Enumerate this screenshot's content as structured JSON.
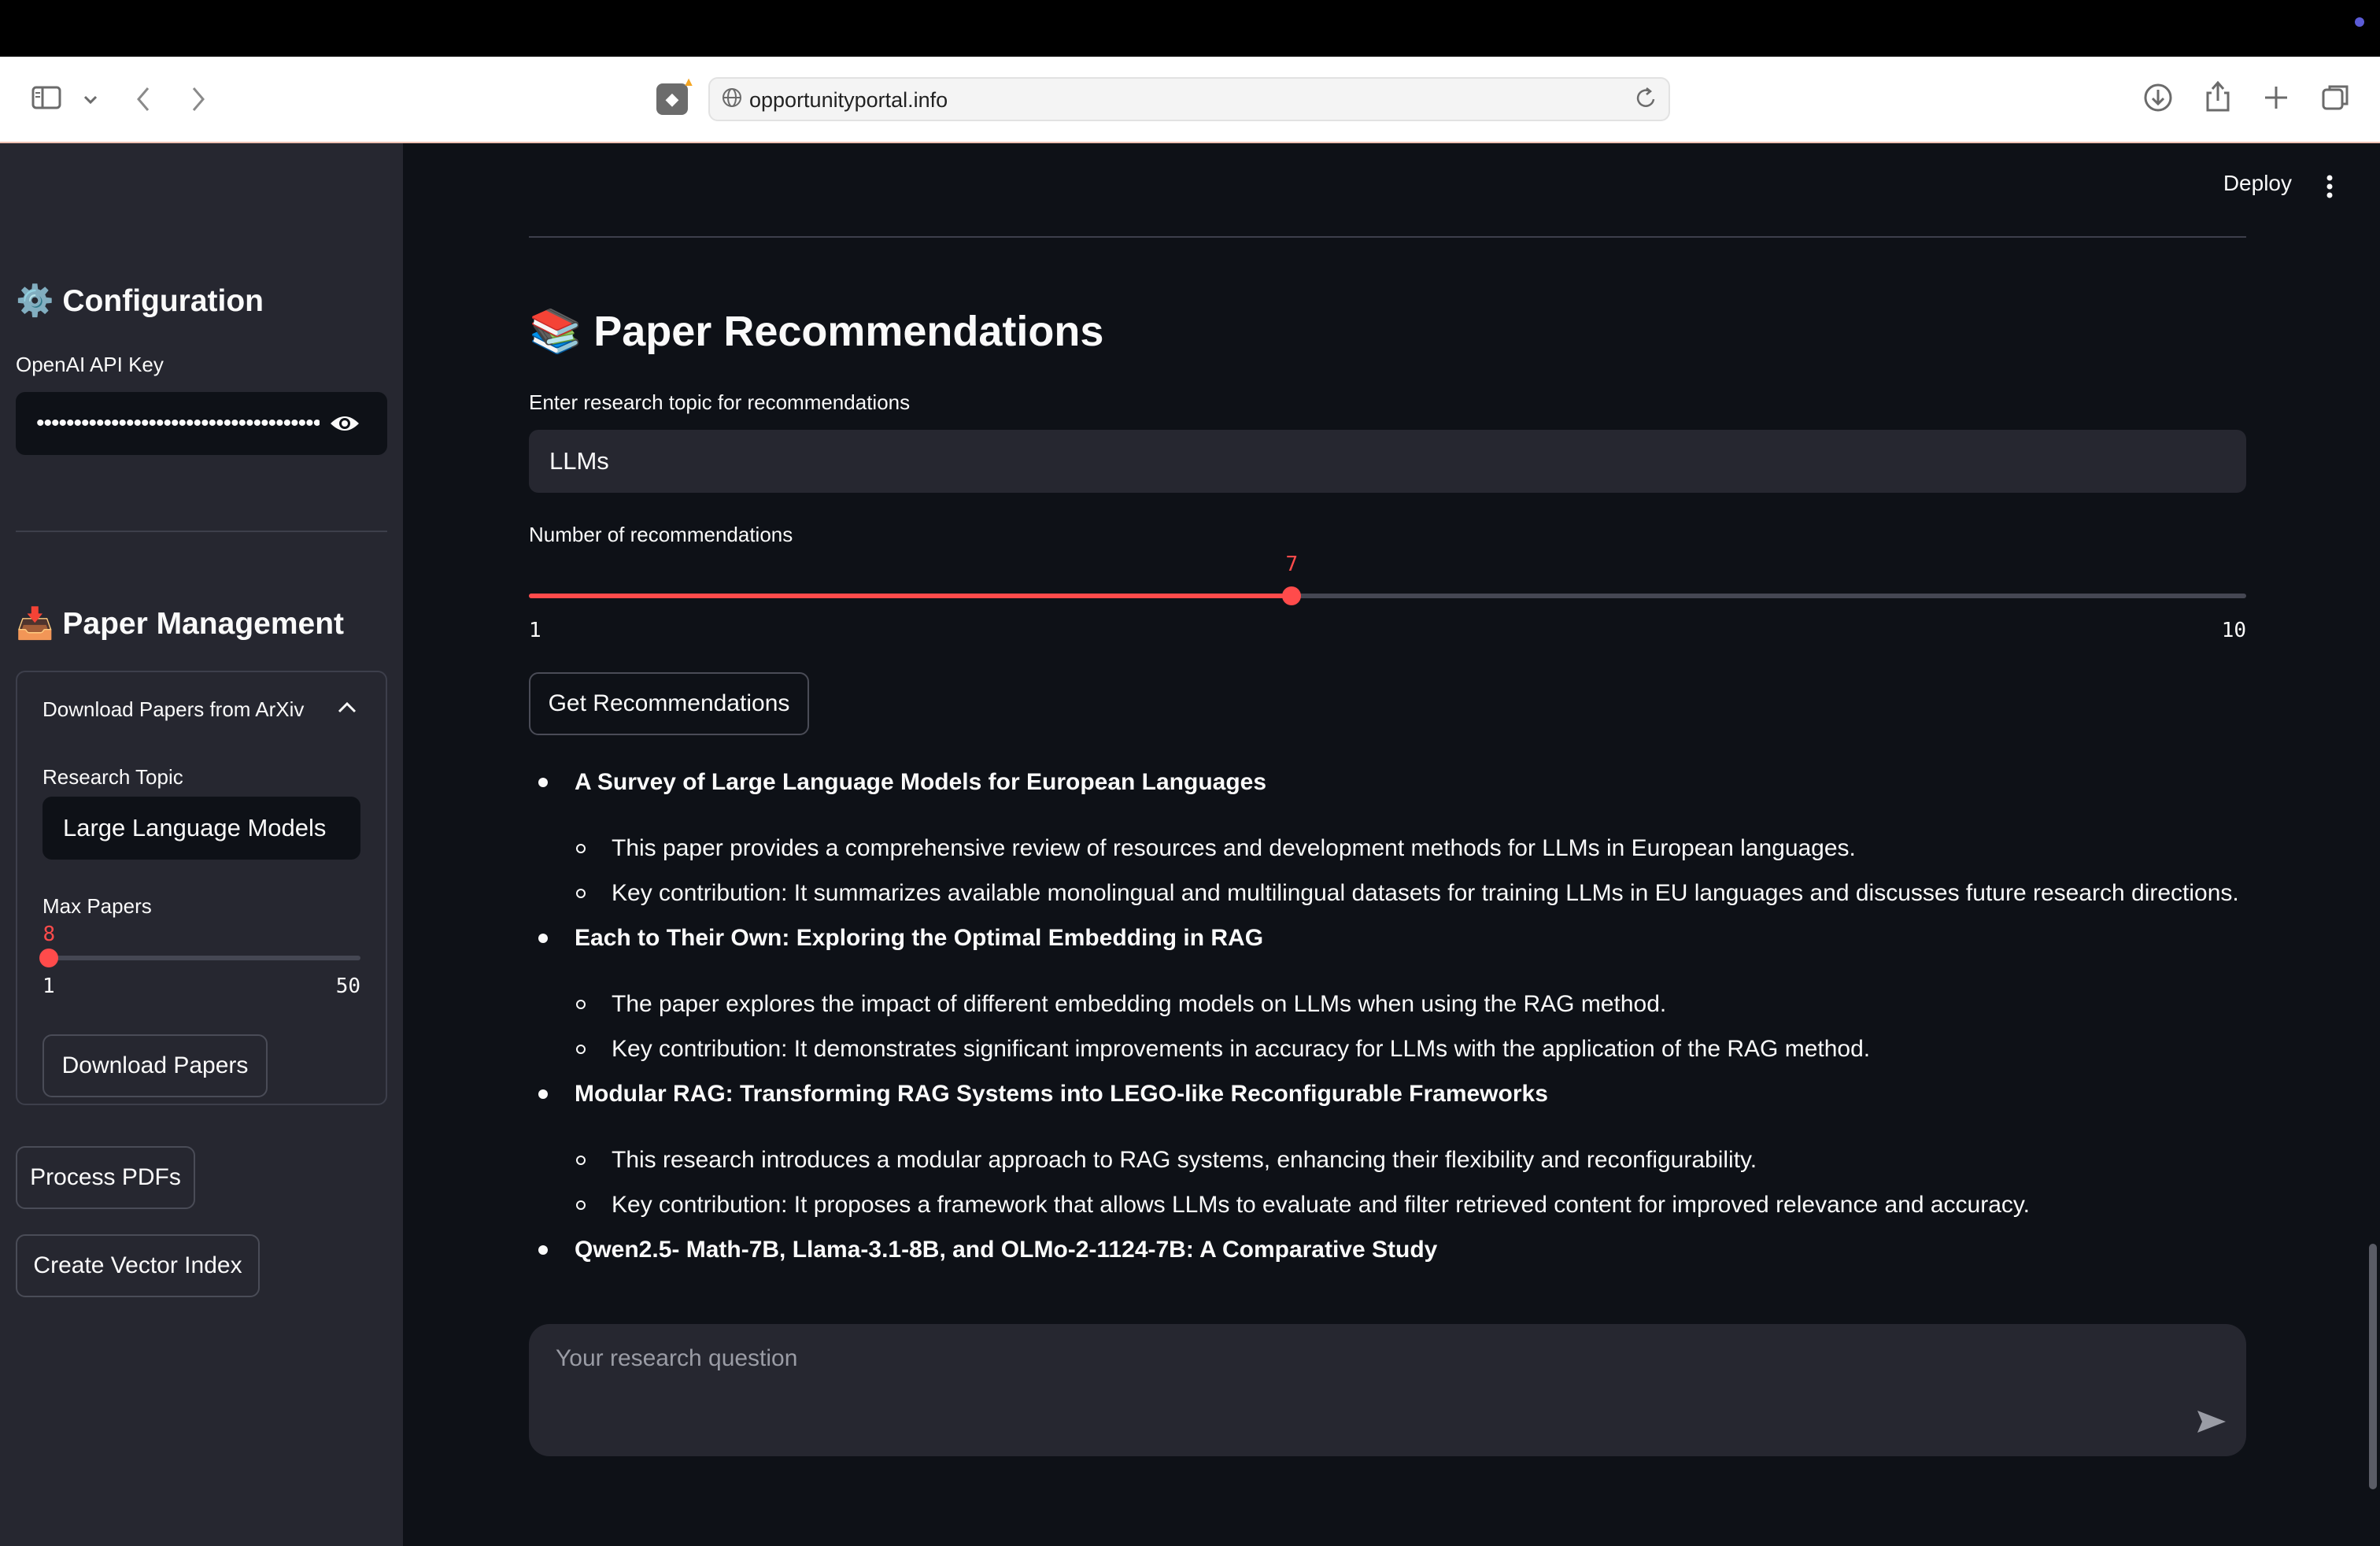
{
  "browser": {
    "url": "opportunityportal.info"
  },
  "sidebar": {
    "config_heading": "⚙️ Configuration",
    "api_key_label": "OpenAI API Key",
    "api_key_value": "••••••••••••••••••••••••••••••••••••••••",
    "management_heading": "📥 Paper Management",
    "expander_title": "Download Papers from ArXiv",
    "research_topic_label": "Research Topic",
    "research_topic_value": "Large Language Models",
    "max_papers_label": "Max Papers",
    "max_papers": {
      "value": 8,
      "min": 1,
      "max": 50,
      "value_text": "8",
      "min_text": "1",
      "max_text": "50"
    },
    "download_button": "Download Papers",
    "process_button": "Process PDFs",
    "vector_button": "Create Vector Index"
  },
  "main": {
    "deploy_label": "Deploy",
    "heading": "📚 Paper Recommendations",
    "topic_label": "Enter research topic for recommendations",
    "topic_value": "LLMs",
    "count_label": "Number of recommendations",
    "count_slider": {
      "value": 7,
      "min": 1,
      "max": 10,
      "value_text": "7",
      "min_text": "1",
      "max_text": "10"
    },
    "get_button": "Get Recommendations",
    "recommendations": [
      {
        "title": "A Survey of Large Language Models for European Languages",
        "points": [
          "This paper provides a comprehensive review of resources and development methods for LLMs in European languages.",
          "Key contribution: It summarizes available monolingual and multilingual datasets for training LLMs in EU languages and discusses future research directions."
        ]
      },
      {
        "title": "Each to Their Own: Exploring the Optimal Embedding in RAG",
        "points": [
          "The paper explores the impact of different embedding models on LLMs when using the RAG method.",
          "Key contribution: It demonstrates significant improvements in accuracy for LLMs with the application of the RAG method."
        ]
      },
      {
        "title": "Modular RAG: Transforming RAG Systems into LEGO-like Reconfigurable Frameworks",
        "points": [
          "This research introduces a modular approach to RAG systems, enhancing their flexibility and reconfigurability.",
          "Key contribution: It proposes a framework that allows LLMs to evaluate and filter retrieved content for improved relevance and accuracy."
        ]
      },
      {
        "title": "Qwen2.5- Math-7B, Llama-3.1-8B, and OLMo-2-1124-7B: A Comparative Study",
        "points": []
      }
    ],
    "chat_placeholder": "Your research question"
  },
  "colors": {
    "accent": "#ff4b4b",
    "sidebar_bg": "#262730",
    "main_bg": "#0e1117"
  },
  "icons": [
    "sidebar-toggle-icon",
    "chevron-down-icon",
    "back-icon",
    "forward-icon",
    "globe-icon",
    "reload-icon",
    "download-icon",
    "share-icon",
    "new-tab-icon",
    "tabs-icon",
    "eye-icon",
    "chevron-up-icon",
    "kebab-menu-icon",
    "send-icon"
  ]
}
